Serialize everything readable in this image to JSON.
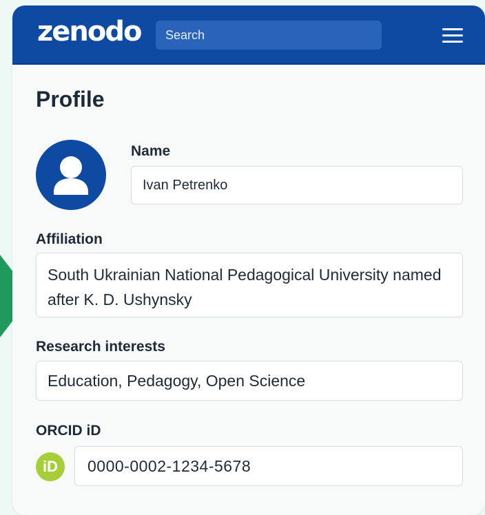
{
  "header": {
    "logo_text": "zenodo",
    "search_placeholder": "Search",
    "brand_color": "#0e4aa2"
  },
  "profile": {
    "title": "Profile",
    "name_label": "Name",
    "name_value": "Ivan Petrenko",
    "affiliation_label": "Affiliation",
    "affiliation_value": "South Ukrainian National Pedagogical University named after K. D. Ushynsky",
    "research_interests_label": "Research interests",
    "research_interests_value": "Education, Pedagogy, Open Science",
    "orcid_label": "ORCID iD",
    "orcid_value": "0000-0002-1234-5678",
    "orcid_icon_text": "iD",
    "orcid_color": "#a6ce39"
  },
  "icons": {
    "menu": "hamburger-icon",
    "avatar": "user-icon",
    "orcid": "orcid-icon"
  }
}
